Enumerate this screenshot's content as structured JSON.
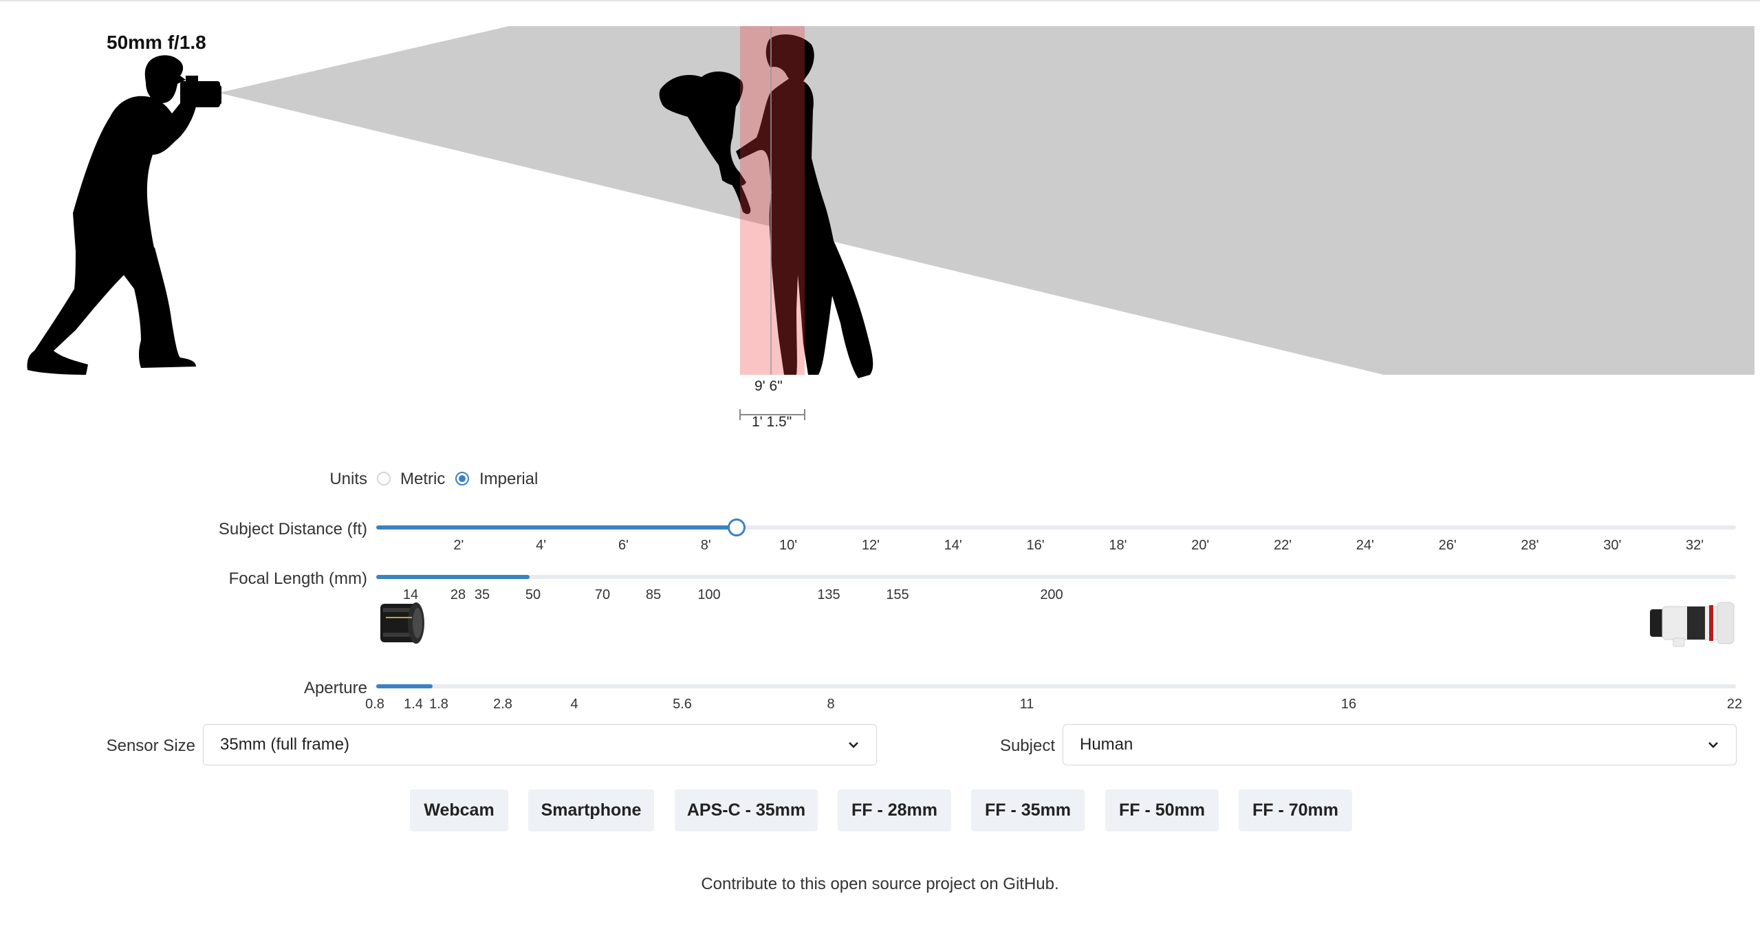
{
  "scene": {
    "lens_label": "50mm f/1.8",
    "focus_distance_label": "9' 6\"",
    "dof_depth_label": "1' 1.5\"",
    "colors": {
      "fov": "#cccccc",
      "dof": "#f4a4a4",
      "silhouette": "#000000"
    }
  },
  "units": {
    "label": "Units",
    "options": [
      {
        "label": "Metric",
        "selected": false
      },
      {
        "label": "Imperial",
        "selected": true
      }
    ]
  },
  "subject_distance": {
    "label": "Subject Distance (ft)",
    "value_ft": 9.5,
    "min_ft": 0,
    "max_ft": 33,
    "ticks": [
      "2'",
      "4'",
      "6'",
      "8'",
      "10'",
      "12'",
      "14'",
      "16'",
      "18'",
      "20'",
      "22'",
      "24'",
      "26'",
      "28'",
      "30'",
      "32'"
    ]
  },
  "focal_length": {
    "label": "Focal Length (mm)",
    "value_mm": 50,
    "ticks": [
      "14",
      "28",
      "35",
      "50",
      "70",
      "85",
      "100",
      "135",
      "155",
      "200"
    ],
    "lens_icons": [
      "wide-angle-lens-icon",
      "telephoto-zoom-lens-icon"
    ]
  },
  "aperture": {
    "label": "Aperture",
    "value": 1.8,
    "ticks": [
      "0.8",
      "1.4",
      "1.8",
      "2.8",
      "4",
      "5.6",
      "8",
      "11",
      "16",
      "22"
    ]
  },
  "sensor_size": {
    "label": "Sensor Size",
    "value": "35mm (full frame)"
  },
  "subject": {
    "label": "Subject",
    "value": "Human"
  },
  "presets": [
    "Webcam",
    "Smartphone",
    "APS-C - 35mm",
    "FF - 28mm",
    "FF - 35mm",
    "FF - 50mm",
    "FF - 70mm"
  ],
  "footer": "Contribute to this open source project on GitHub.",
  "accent_color": "#3b82c4"
}
